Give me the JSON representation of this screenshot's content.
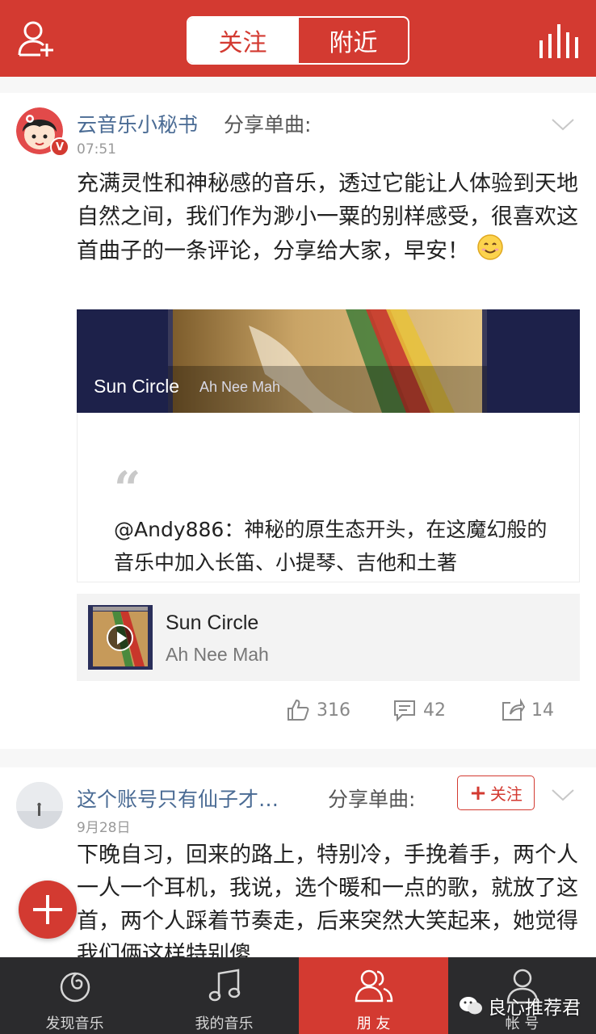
{
  "header": {
    "tabs": [
      {
        "label": "关注",
        "active": true
      },
      {
        "label": "附近",
        "active": false
      }
    ],
    "add_friend_icon": "add-user-icon",
    "chart_icon": "bars-icon",
    "accent_color": "#d33a31"
  },
  "posts": [
    {
      "user": "云音乐小秘书",
      "action": "分享单曲:",
      "time": "07:51",
      "verified_badge": "V",
      "text": "充满灵性和神秘感的音乐，透过它能让人体验到天地自然之间，我们作为渺小一粟的别样感受，很喜欢这首曲子的一条评论，分享给大家，早安！",
      "banner": {
        "title": "Sun Circle",
        "artist": "Ah Nee Mah"
      },
      "quote": {
        "mark": "“",
        "text": "@Andy886：神秘的原生态开头，在这魔幻般的音乐中加入长笛、小提琴、吉他和土著"
      },
      "song": {
        "title": "Sun Circle",
        "artist": "Ah Nee Mah"
      },
      "stats": {
        "likes": "316",
        "comments": "42",
        "shares": "14"
      }
    },
    {
      "user": "这个账号只有仙子才…",
      "action": "分享单曲:",
      "time": "9月28日",
      "follow_label": "关注",
      "follow_plus": "+",
      "text": "下晚自习，回来的路上，特别冷，手挽着手，两个人一人一个耳机，我说，选个暖和一点的歌，就放了这首，两个人踩着节奏走，后来突然大笑起来，她觉得我们俩这样特别傻"
    }
  ],
  "bottom_nav": [
    {
      "label": "发现音乐",
      "icon": "discover-icon",
      "active": false
    },
    {
      "label": "我的音乐",
      "icon": "music-note-icon",
      "active": false
    },
    {
      "label": "朋 友",
      "icon": "friends-icon",
      "active": true
    },
    {
      "label": "帐 号",
      "icon": "account-icon",
      "active": false
    }
  ],
  "watermark": "良心推荐君"
}
